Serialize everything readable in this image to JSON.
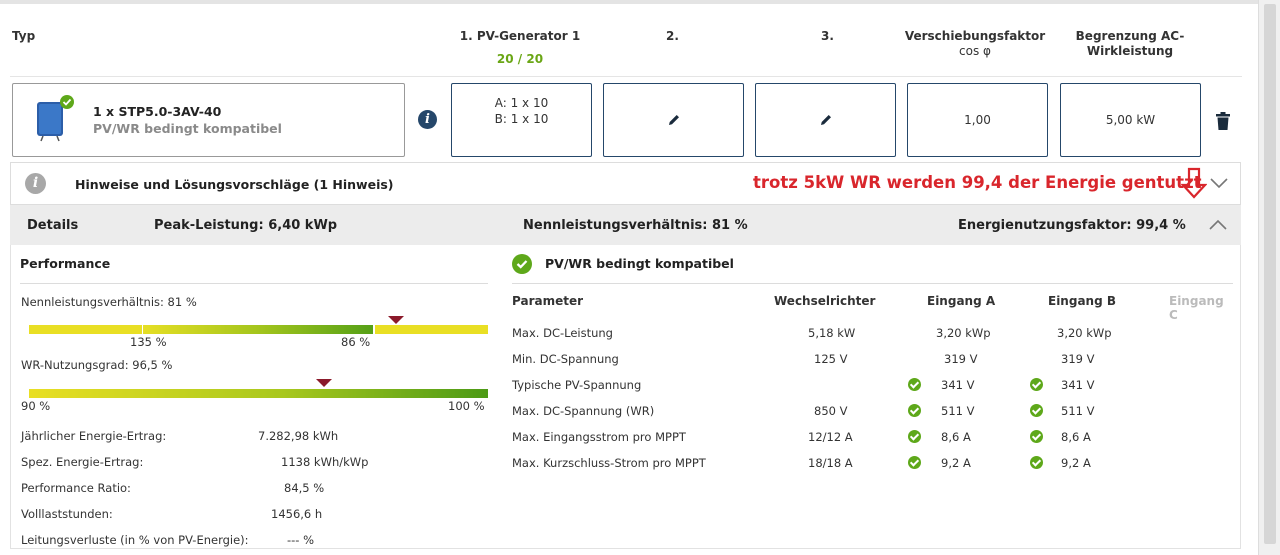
{
  "header": {
    "typ": "Typ",
    "col1": "1. PV-Generator 1",
    "col1_count": "20 / 20",
    "col2": "2.",
    "col3": "3.",
    "col4_line1": "Verschiebungsfaktor",
    "col4_line2": "cos φ",
    "col5_line1": "Begrenzung AC-",
    "col5_line2": "Wirkleistung"
  },
  "device": {
    "name": "1 x STP5.0-3AV-40",
    "status": "PV/WR bedingt kompatibel",
    "string_a": "A: 1 x 10",
    "string_b": "B: 1 x 10",
    "cos_phi": "1,00",
    "ac_limit": "5,00 kW"
  },
  "hints": {
    "label": "Hinweise und Lösungsvorschläge (1 Hinweis)",
    "annotation": "trotz 5kW WR werden 99,4 der Energie gentutzt"
  },
  "details_bar": {
    "details": "Details",
    "peak": "Peak-Leistung: 6,40 kWp",
    "ratio": "Nennleistungsverhältnis: 81 %",
    "energy_factor": "Energienutzungsfaktor: 99,4 %"
  },
  "performance": {
    "title": "Performance",
    "ratio_label": "Nennleistungsverhältnis: 81 %",
    "ratio_tick_left": "135 %",
    "ratio_tick_right": "86 %",
    "wr_label": "WR-Nutzungsgrad: 96,5 %",
    "wr_min": "90 %",
    "wr_max": "100 %",
    "rows": [
      {
        "label": "Jährlicher Energie-Ertrag:",
        "value": "7.282,98 kWh"
      },
      {
        "label": "Spez. Energie-Ertrag:",
        "value": "1138 kWh/kWp"
      },
      {
        "label": "Performance Ratio:",
        "value": "84,5 %"
      },
      {
        "label": "Volllaststunden:",
        "value": "1456,6 h"
      },
      {
        "label": "Leitungsverluste (in % von PV-Energie):",
        "value": "--- %"
      }
    ]
  },
  "compat": {
    "title": "PV/WR bedingt kompatibel",
    "columns": [
      "Parameter",
      "Wechselrichter",
      "Eingang A",
      "Eingang B",
      "Eingang C"
    ],
    "rows": [
      {
        "param": "Max. DC-Leistung",
        "wr": "5,18 kW",
        "a": "3,20 kWp",
        "b": "3,20 kWp",
        "check": false
      },
      {
        "param": "Min. DC-Spannung",
        "wr": "125 V",
        "a": "319 V",
        "b": "319 V",
        "check": false
      },
      {
        "param": "Typische PV-Spannung",
        "wr": "",
        "a": "341 V",
        "b": "341 V",
        "check": true
      },
      {
        "param": "Max. DC-Spannung (WR)",
        "wr": "850 V",
        "a": "511 V",
        "b": "511 V",
        "check": true
      },
      {
        "param": "Max. Eingangsstrom pro MPPT",
        "wr": "12/12 A",
        "a": "8,6 A",
        "b": "8,6 A",
        "check": true
      },
      {
        "param": "Max. Kurzschluss-Strom pro MPPT",
        "wr": "18/18 A",
        "a": "9,2 A",
        "b": "9,2 A",
        "check": true
      }
    ]
  },
  "colors": {
    "navy": "#25476a",
    "green": "#6aa615",
    "annotation_red": "#d9262c",
    "marker": "#8b1a2b"
  }
}
